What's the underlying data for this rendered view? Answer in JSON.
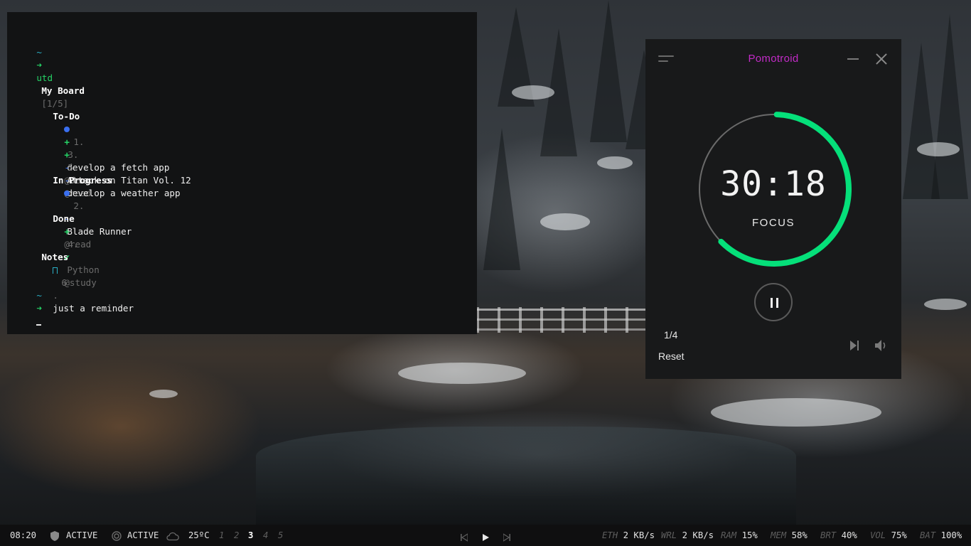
{
  "terminal": {
    "prompt_tilde": "~",
    "prompt_arrow": "➜",
    "command": "utd",
    "board_title": "My Board",
    "board_count": "[1/5]",
    "sections": {
      "todo": {
        "title": "To-Do",
        "items": [
          {
            "marker": "dot",
            "num": "1.",
            "status": "-",
            "text": "develop a fetch app",
            "tag": "@dev"
          },
          {
            "marker": "plus",
            "num": "3.",
            "status": "-",
            "text": "Attack on Titan Vol. 12",
            "tag": "@read"
          },
          {
            "marker": "plus",
            "num": "5.",
            "status": "-",
            "text": "develop a weather app",
            "tag": ""
          }
        ]
      },
      "in_progress": {
        "title": "In Progress",
        "items": [
          {
            "marker": "dot",
            "num": "2.",
            "status": "-",
            "text": "Blade Runner",
            "tag": "@read"
          }
        ]
      },
      "done": {
        "title": "Done",
        "items": [
          {
            "marker": "plus",
            "num": "4.",
            "status": "✔",
            "text": "Python",
            "tag": "@study"
          }
        ]
      }
    },
    "notes": {
      "title": "Notes",
      "items": [
        {
          "num": "6",
          "sep": ".",
          "text": "just a reminder"
        }
      ]
    },
    "plus_glyph": "+",
    "dash_glyph": "-"
  },
  "pomotroid": {
    "title": "Pomotroid",
    "time": "30:18",
    "mode": "FOCUS",
    "round": "1/4",
    "reset_label": "Reset",
    "progress": 0.62,
    "accent_color": "#05e07a",
    "title_color": "#c22bc7"
  },
  "statusbar": {
    "time": "08:20",
    "vpn_status": "ACTIVE",
    "wifi_status": "ACTIVE",
    "weather": "25ºC",
    "workspaces": [
      "1",
      "2",
      "3",
      "4",
      "5"
    ],
    "active_workspace": "3",
    "eth": {
      "label": "ETH",
      "value": "2 KB/s"
    },
    "wrl": {
      "label": "WRL",
      "value": "2 KB/s"
    },
    "ram": {
      "label": "RAM",
      "value": "15%"
    },
    "mem": {
      "label": "MEM",
      "value": "58%"
    },
    "brt": {
      "label": "BRT",
      "value": "40%"
    },
    "vol": {
      "label": "VOL",
      "value": "75%"
    },
    "bat": {
      "label": "BAT",
      "value": "100%"
    }
  }
}
